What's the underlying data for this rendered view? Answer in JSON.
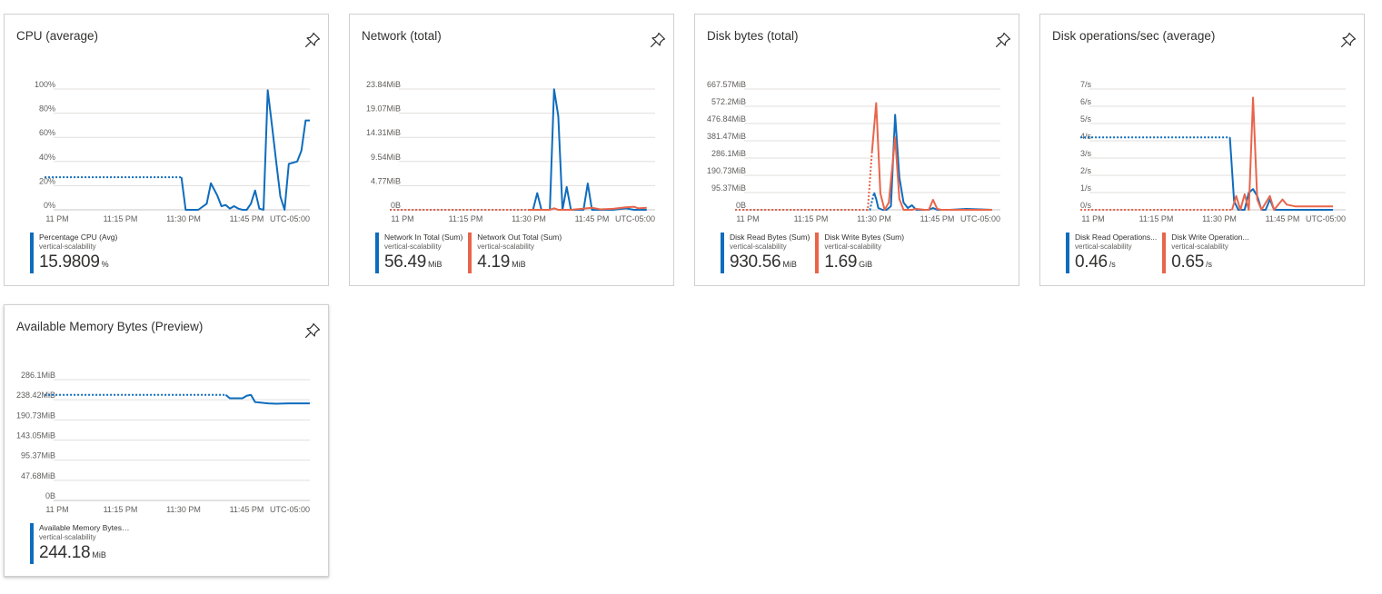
{
  "colors": {
    "blue": "#0f6cbd",
    "orange": "#e8654a",
    "grid": "#e1dfdd",
    "axis": "#c8c6c4"
  },
  "pin_icon": "pin-icon",
  "tiles": [
    {
      "title": "CPU (average)",
      "x_ticks": [
        "11 PM",
        "11:15 PM",
        "11:30 PM",
        "11:45 PM",
        "UTC-05:00"
      ],
      "legend": [
        {
          "color": "#0f6cbd",
          "name": "Percentage CPU (Avg)",
          "resource": "vertical-scalability",
          "value": "15.9809",
          "unit": "%"
        }
      ]
    },
    {
      "title": "Network (total)",
      "x_ticks": [
        "11 PM",
        "11:15 PM",
        "11:30 PM",
        "11:45 PM",
        "UTC-05:00"
      ],
      "legend": [
        {
          "color": "#0f6cbd",
          "name": "Network In Total (Sum)",
          "resource": "vertical-scalability",
          "value": "56.49",
          "unit": "MiB"
        },
        {
          "color": "#e8654a",
          "name": "Network Out Total (Sum)",
          "resource": "vertical-scalability",
          "value": "4.19",
          "unit": "MiB"
        }
      ]
    },
    {
      "title": "Disk bytes (total)",
      "x_ticks": [
        "11 PM",
        "11:15 PM",
        "11:30 PM",
        "11:45 PM",
        "UTC-05:00"
      ],
      "legend": [
        {
          "color": "#0f6cbd",
          "name": "Disk Read Bytes (Sum)",
          "resource": "vertical-scalability",
          "value": "930.56",
          "unit": "MiB"
        },
        {
          "color": "#e8654a",
          "name": "Disk Write Bytes (Sum)",
          "resource": "vertical-scalability",
          "value": "1.69",
          "unit": "GiB"
        }
      ]
    },
    {
      "title": "Disk operations/sec (average)",
      "x_ticks": [
        "11 PM",
        "11:15 PM",
        "11:30 PM",
        "11:45 PM",
        "UTC-05:00"
      ],
      "legend": [
        {
          "color": "#0f6cbd",
          "name": "Disk Read Operations...",
          "resource": "vertical-scalability",
          "value": "0.46",
          "unit": "/s"
        },
        {
          "color": "#e8654a",
          "name": "Disk Write Operation...",
          "resource": "vertical-scalability",
          "value": "0.65",
          "unit": "/s"
        }
      ]
    },
    {
      "title": "Available Memory Bytes (Preview)",
      "x_ticks": [
        "11 PM",
        "11:15 PM",
        "11:30 PM",
        "11:45 PM",
        "UTC-05:00"
      ],
      "legend": [
        {
          "color": "#0f6cbd",
          "name": "Available Memory Bytes (Preview) (Avg)",
          "resource": "vertical-scalability",
          "value": "244.18",
          "unit": "MiB"
        }
      ]
    }
  ],
  "chart_data": [
    {
      "type": "line",
      "title": "CPU (average)",
      "y_ticks": [
        "0%",
        "20%",
        "40%",
        "60%",
        "80%",
        "100%"
      ],
      "ylim": [
        0,
        100
      ],
      "x_unit": "minutes",
      "xlim": [
        0,
        60
      ],
      "series": [
        {
          "name": "Percentage CPU (Avg)",
          "color": "#0f6cbd",
          "dashed": [
            [
              -3,
              27
            ],
            [
              29.5,
              27
            ]
          ],
          "points": [
            [
              29.5,
              27
            ],
            [
              30.5,
              0
            ],
            [
              33.5,
              0
            ],
            [
              35.5,
              5
            ],
            [
              36.5,
              22
            ],
            [
              38,
              12
            ],
            [
              39,
              3
            ],
            [
              40,
              4
            ],
            [
              41,
              1
            ],
            [
              42,
              3
            ],
            [
              43,
              1
            ],
            [
              44,
              0
            ],
            [
              45,
              0
            ],
            [
              46,
              5
            ],
            [
              47,
              16
            ],
            [
              48,
              1
            ],
            [
              49,
              0
            ],
            [
              50,
              99
            ],
            [
              51,
              70
            ],
            [
              52,
              40
            ],
            [
              53,
              11
            ],
            [
              54,
              0
            ],
            [
              55,
              38
            ],
            [
              56,
              39
            ],
            [
              57,
              40
            ],
            [
              58,
              49
            ],
            [
              59,
              74
            ],
            [
              60,
              74
            ]
          ]
        }
      ]
    },
    {
      "type": "line",
      "title": "Network (total)",
      "y_ticks": [
        "0B",
        "4.77MiB",
        "9.54MiB",
        "14.31MiB",
        "19.07MiB",
        "23.84MiB"
      ],
      "ylim": [
        0,
        23.84
      ],
      "x_unit": "minutes",
      "xlim": [
        0,
        60
      ],
      "series": [
        {
          "name": "Network In Total (Sum)",
          "color": "#0f6cbd",
          "dashed": [
            [
              -3,
              0
            ],
            [
              30,
              0
            ]
          ],
          "points": [
            [
              30,
              0
            ],
            [
              31,
              0
            ],
            [
              32,
              3.3
            ],
            [
              33,
              0
            ],
            [
              35,
              0
            ],
            [
              36,
              23.8
            ],
            [
              37,
              18.5
            ],
            [
              38,
              0
            ],
            [
              39,
              4.5
            ],
            [
              40,
              0
            ],
            [
              41,
              0
            ],
            [
              43,
              0
            ],
            [
              44,
              5.2
            ],
            [
              45,
              0
            ],
            [
              50,
              0
            ],
            [
              53,
              0.3
            ],
            [
              55,
              0
            ],
            [
              58,
              0
            ]
          ]
        },
        {
          "name": "Network Out Total (Sum)",
          "color": "#e8654a",
          "dashed": [
            [
              -3,
              0
            ],
            [
              30,
              0
            ]
          ],
          "points": [
            [
              30,
              0
            ],
            [
              35,
              0
            ],
            [
              36,
              0.3
            ],
            [
              37,
              0
            ],
            [
              40,
              0
            ],
            [
              45,
              0.4
            ],
            [
              47,
              0.1
            ],
            [
              50,
              0.2
            ],
            [
              53,
              0.5
            ],
            [
              55,
              0.6
            ],
            [
              56,
              0.3
            ],
            [
              58,
              0.4
            ]
          ]
        }
      ]
    },
    {
      "type": "line",
      "title": "Disk bytes (total)",
      "y_ticks": [
        "0B",
        "95.37MiB",
        "190.73MiB",
        "286.1MiB",
        "381.47MiB",
        "476.84MiB",
        "572.2MiB",
        "667.57MiB"
      ],
      "ylim": [
        0,
        667.57
      ],
      "x_unit": "minutes",
      "xlim": [
        0,
        60
      ],
      "series": [
        {
          "name": "Disk Read Bytes (Sum)",
          "color": "#0f6cbd",
          "dashed": [
            [
              -3,
              0
            ],
            [
              29,
              0
            ],
            [
              30,
              95
            ]
          ],
          "points": [
            [
              30,
              95
            ],
            [
              30.5,
              60
            ],
            [
              31,
              10
            ],
            [
              32,
              0
            ],
            [
              33,
              0
            ],
            [
              34,
              20
            ],
            [
              35,
              525
            ],
            [
              36,
              180
            ],
            [
              37,
              40
            ],
            [
              38,
              10
            ],
            [
              39,
              25
            ],
            [
              40,
              0
            ],
            [
              43,
              0
            ],
            [
              44,
              10
            ],
            [
              45,
              0
            ],
            [
              48,
              0
            ],
            [
              52,
              5
            ],
            [
              58,
              0
            ]
          ]
        },
        {
          "name": "Disk Write Bytes (Sum)",
          "color": "#e8654a",
          "dashed": [
            [
              -3,
              0
            ],
            [
              28.5,
              0
            ],
            [
              29.5,
              320
            ]
          ],
          "points": [
            [
              29.5,
              320
            ],
            [
              30.5,
              590
            ],
            [
              31.5,
              90
            ],
            [
              32.5,
              0
            ],
            [
              33.5,
              40
            ],
            [
              35,
              400
            ],
            [
              36,
              60
            ],
            [
              37,
              0
            ],
            [
              39,
              0
            ],
            [
              40,
              5
            ],
            [
              42,
              0
            ],
            [
              43,
              0
            ],
            [
              44,
              55
            ],
            [
              45,
              5
            ],
            [
              46,
              0
            ],
            [
              50,
              0
            ],
            [
              58,
              0
            ]
          ]
        }
      ]
    },
    {
      "type": "line",
      "title": "Disk operations/sec (average)",
      "y_ticks": [
        "0/s",
        "1/s",
        "2/s",
        "3/s",
        "4/s",
        "5/s",
        "6/s",
        "7/s"
      ],
      "ylim": [
        0,
        7
      ],
      "x_unit": "minutes",
      "xlim": [
        0,
        60
      ],
      "series": [
        {
          "name": "Disk Read Operations...",
          "color": "#0f6cbd",
          "dashed": [
            [
              -3,
              4.2
            ],
            [
              32.5,
              4.2
            ]
          ],
          "points": [
            [
              32.5,
              4.2
            ],
            [
              33.5,
              0.5
            ],
            [
              34.5,
              0
            ],
            [
              36,
              0
            ],
            [
              37,
              1
            ],
            [
              38,
              1.2
            ],
            [
              39,
              0.8
            ],
            [
              40,
              0
            ],
            [
              41,
              0
            ],
            [
              42,
              0.6
            ],
            [
              43,
              0
            ],
            [
              44,
              0
            ],
            [
              48,
              0
            ],
            [
              51,
              0
            ],
            [
              57,
              0
            ]
          ]
        },
        {
          "name": "Disk Write Operation...",
          "color": "#e8654a",
          "dashed": [
            [
              -3,
              0
            ],
            [
              33,
              0
            ]
          ],
          "points": [
            [
              33,
              0
            ],
            [
              34,
              0.8
            ],
            [
              35,
              0
            ],
            [
              36,
              0.9
            ],
            [
              37,
              0
            ],
            [
              38,
              6.5
            ],
            [
              39,
              0.6
            ],
            [
              40,
              0
            ],
            [
              41,
              0.4
            ],
            [
              42,
              0.8
            ],
            [
              43,
              0
            ],
            [
              44,
              0.3
            ],
            [
              45,
              0.6
            ],
            [
              46,
              0.3
            ],
            [
              48,
              0.2
            ],
            [
              51,
              0.2
            ],
            [
              57,
              0.2
            ]
          ]
        }
      ]
    },
    {
      "type": "line",
      "title": "Available Memory Bytes (Preview)",
      "y_ticks": [
        "0B",
        "47.68MiB",
        "95.37MiB",
        "143.05MiB",
        "190.73MiB",
        "238.42MiB",
        "286.1MiB"
      ],
      "ylim": [
        0,
        286.1
      ],
      "x_unit": "minutes",
      "xlim": [
        0,
        60
      ],
      "series": [
        {
          "name": "Available Memory Bytes (Preview) (Avg)",
          "color": "#0f6cbd",
          "dashed": [
            [
              -3,
              250
            ],
            [
              40,
              250
            ]
          ],
          "points": [
            [
              40,
              250
            ],
            [
              41,
              242
            ],
            [
              42,
              242
            ],
            [
              44,
              242
            ],
            [
              45,
              248
            ],
            [
              46,
              250
            ],
            [
              47,
              233
            ],
            [
              48,
              232
            ],
            [
              50,
              230
            ],
            [
              52,
              229
            ],
            [
              55,
              230
            ],
            [
              58,
              230
            ],
            [
              60,
              230
            ]
          ]
        }
      ]
    }
  ]
}
